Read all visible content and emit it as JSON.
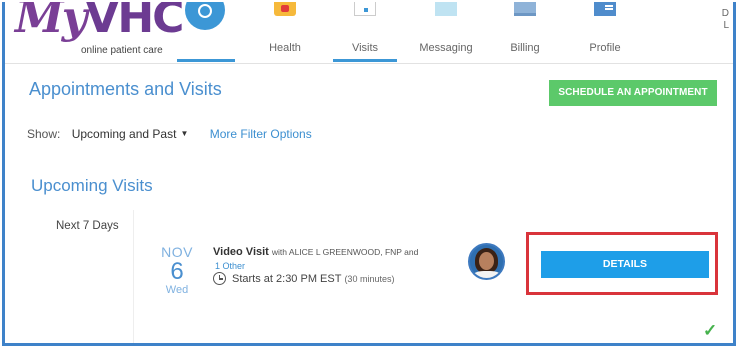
{
  "app": {
    "brand_my": "My",
    "brand_vhc": "VHC",
    "tagline": "online patient care"
  },
  "nav": {
    "items": [
      {
        "label": "Health",
        "icon": "health-icon"
      },
      {
        "label": "Visits",
        "icon": "visits-icon",
        "active": true
      },
      {
        "label": "Messaging",
        "icon": "messaging-icon"
      },
      {
        "label": "Billing",
        "icon": "billing-icon"
      },
      {
        "label": "Profile",
        "icon": "profile-icon"
      }
    ],
    "user_edge_line1": "D",
    "user_edge_line2": "L"
  },
  "page": {
    "title": "Appointments and Visits",
    "schedule_button": "SCHEDULE AN APPOINTMENT",
    "show_label": "Show:",
    "show_value": "Upcoming and Past",
    "filter_link": "More Filter Options",
    "section_title": "Upcoming Visits",
    "range_label": "Next 7 Days"
  },
  "visit": {
    "month": "NOV",
    "day": "6",
    "weekday": "Wed",
    "type": "Video Visit",
    "with_text": "with ALICE L GREENWOOD, FNP and",
    "other_link": "1 Other",
    "start_text": "Starts at 2:30 PM EST",
    "duration": "(30 minutes)",
    "details_button": "DETAILS"
  },
  "colors": {
    "accent": "#3c97d6",
    "title_blue": "#4a8fcf",
    "schedule_green": "#5cc96a",
    "details_blue": "#1e9ee8",
    "highlight_red": "#d9343b",
    "brand_purple": "#6c3b92"
  }
}
